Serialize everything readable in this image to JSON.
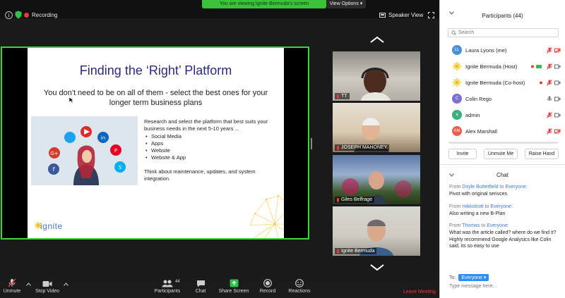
{
  "meeting": {
    "recording_label": "Recording",
    "viewing_banner": "You are viewing Ignite Bermuda's screen",
    "view_options_label": "View Options",
    "speaker_view_label": "Speaker View"
  },
  "slide": {
    "title": "Finding the ‘Right’ Platform",
    "subtitle": "You don't need to be on all of them - select the best ones for your longer term business plans",
    "body_intro": "Research and select the platform that best suits your business needs in the next 5-10 years ...",
    "bullets": [
      "Social Media",
      "Apps",
      "Website",
      "Website & App"
    ],
    "note": "Think about maintenance, updates, and system integration.",
    "logo_text": "ignite"
  },
  "videos": [
    {
      "name": "TT"
    },
    {
      "name": "JOSEPH MAHONEY"
    },
    {
      "name": "Giles Belfrage"
    },
    {
      "name": "Ignite Bermuda"
    }
  ],
  "toolbar": {
    "unmute_label": "Unmute",
    "stop_video_label": "Stop Video",
    "participants_label": "Participants",
    "participants_count": "44",
    "chat_label": "Chat",
    "share_screen_label": "Share Screen",
    "record_label": "Record",
    "reactions_label": "Reactions",
    "leave_label": "Leave Meeting"
  },
  "participants_panel": {
    "title": "Participants (44)",
    "search_placeholder": "Search",
    "people": [
      {
        "initials": "LL",
        "color": "#4a90d9",
        "name": "Laura Lyons (me)"
      },
      {
        "initials": "",
        "color": "#f5c518",
        "name": "Ignite Bermuda (Host)"
      },
      {
        "initials": "",
        "color": "#f5c518",
        "name": "Ignite Bermuda (Co-host)"
      },
      {
        "initials": "C",
        "color": "#7b6fd6",
        "name": "Colin Rego"
      },
      {
        "initials": "a",
        "color": "#3bb07c",
        "name": "admin"
      },
      {
        "initials": "AM",
        "color": "#e8604c",
        "name": "Alex Marshall"
      }
    ],
    "invite_label": "Invite",
    "unmute_me_label": "Unmute Me",
    "raise_hand_label": "Raise Hand"
  },
  "chat_panel": {
    "title": "Chat",
    "messages": [
      {
        "from_prefix": "From ",
        "sender": "Doyle Butterfield",
        "to_prefix": " to ",
        "recipient": "Everyone",
        "suffix": ":",
        "text": "Pivot with original serivces"
      },
      {
        "from_prefix": "From ",
        "sender": "mikkotrott",
        "to_prefix": " to ",
        "recipient": "Everyone",
        "suffix": ":",
        "text": "Also writing a new B-Plan"
      },
      {
        "from_prefix": "From ",
        "sender": "Thomas",
        "to_prefix": " to ",
        "recipient": "Everyone",
        "suffix": ":",
        "text": "What was the article called? where do we find it?",
        "text2": "Highly recommend Google Analysics like Colin said, its so easy to use"
      }
    ],
    "to_label": "To:",
    "to_value": "Everyone",
    "input_placeholder": "Type message here..."
  },
  "colors": {
    "active_speaker_border": "#3fd33f",
    "banner_green": "#3ac23a",
    "zoom_blue": "#2d8cff",
    "mute_red": "#e23b3b",
    "slide_title": "#2c2a7c"
  }
}
